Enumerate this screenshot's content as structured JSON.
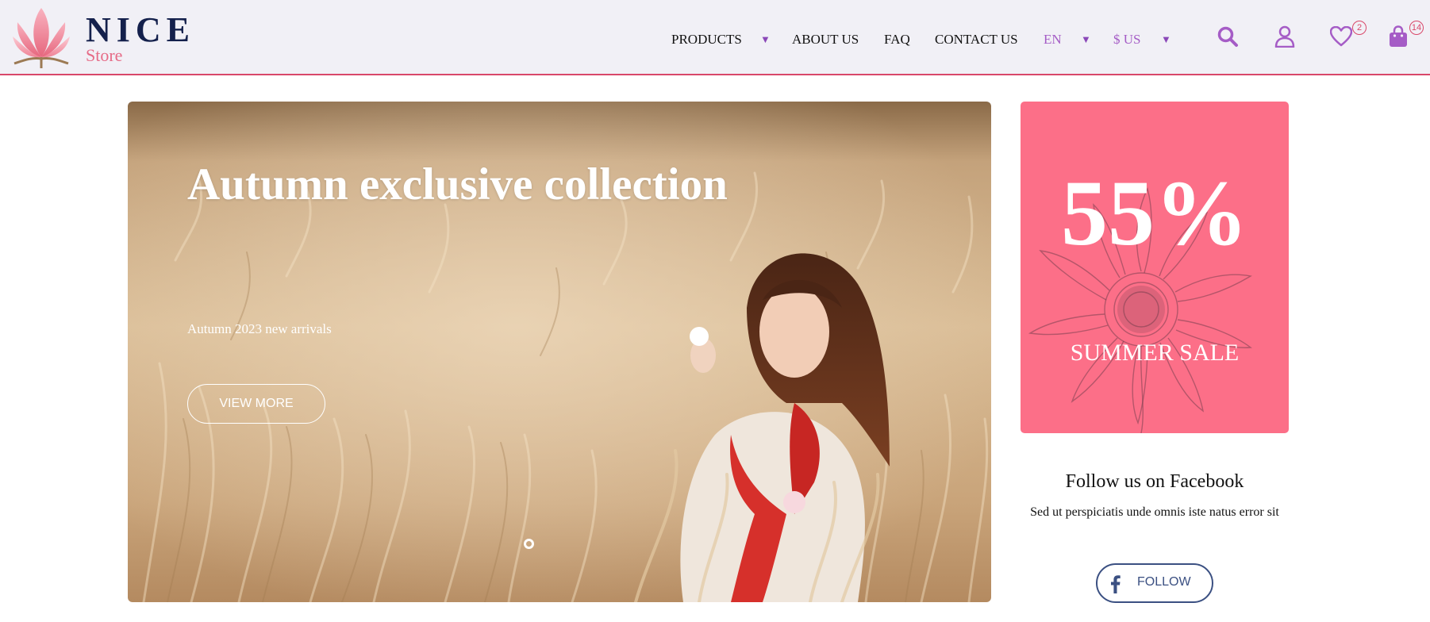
{
  "brand": {
    "name": "NICE",
    "sub": "Store"
  },
  "nav": {
    "products": "PRODUCTS",
    "about": "ABOUT US",
    "faq": "FAQ",
    "contact": "CONTACT US",
    "language": "EN",
    "currency": "$ US"
  },
  "header_icons": {
    "search": "search-icon",
    "account": "user-icon",
    "wishlist": "heart-icon",
    "wishlist_count": "2",
    "cart": "shopping-bag-icon",
    "cart_count": "14"
  },
  "hero": {
    "title": "Autumn exclusive collection",
    "subtitle": "Autumn 2023 new arrivals",
    "button": "VIEW MORE"
  },
  "sale": {
    "percent": "55%",
    "label": "SUMMER SALE"
  },
  "facebook": {
    "title": "Follow us on Facebook",
    "text": "Sed ut perspiciatis unde omnis iste natus error sit",
    "button": "FOLLOW"
  },
  "colors": {
    "accent_purple": "#a55cc6",
    "brand_navy": "#14204c",
    "brand_pink": "#e66b87",
    "sale_bg": "#fc6f88",
    "facebook_blue": "#3b5082",
    "header_bg": "#f1f0f6",
    "header_border": "#d9486a"
  }
}
